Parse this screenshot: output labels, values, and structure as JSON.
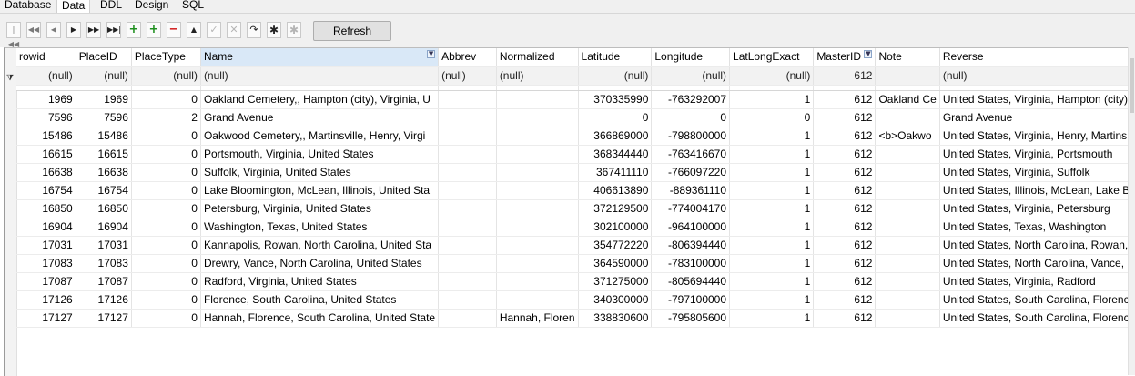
{
  "tabs": [
    {
      "label": "Database"
    },
    {
      "label": "Data"
    },
    {
      "label": "DDL"
    },
    {
      "label": "Design"
    },
    {
      "label": "SQL"
    }
  ],
  "toolbar": {
    "refresh_label": "Refresh",
    "buttons": [
      {
        "name": "first-record-button",
        "icon": "first-icon"
      },
      {
        "name": "prior-page-button",
        "icon": "prior-page-icon"
      },
      {
        "name": "prior-record-button",
        "icon": "prior-icon"
      },
      {
        "name": "next-record-button",
        "icon": "next-icon"
      },
      {
        "name": "next-page-button",
        "icon": "next-page-icon"
      },
      {
        "name": "last-record-button",
        "icon": "last-icon"
      },
      {
        "name": "insert-record-button",
        "icon": "plus-icon"
      },
      {
        "name": "insert-copy-button",
        "icon": "plus-copy-icon"
      },
      {
        "name": "delete-record-button",
        "icon": "minus-icon"
      },
      {
        "name": "edit-record-button",
        "icon": "caret-up-icon"
      },
      {
        "name": "post-edit-button",
        "icon": "checkmark-icon"
      },
      {
        "name": "cancel-edit-button",
        "icon": "x-icon"
      },
      {
        "name": "refresh-record-button",
        "icon": "redo-arrow-icon"
      },
      {
        "name": "apply-updates-button",
        "icon": "asterisk-icon"
      },
      {
        "name": "cancel-updates-button",
        "icon": "asterisk-light-icon"
      }
    ]
  },
  "grid": {
    "columns": [
      "rowid",
      "PlaceID",
      "PlaceType",
      "Name",
      "Abbrev",
      "Normalized",
      "Latitude",
      "Longitude",
      "LatLongExact",
      "MasterID",
      "Note",
      "Reverse"
    ],
    "filters": [
      "(null)",
      "(null)",
      "(null)",
      "(null)",
      "(null)",
      "(null)",
      "(null)",
      "(null)",
      "(null)",
      "612",
      "",
      "(null)"
    ],
    "rows": [
      [
        "1969",
        "1969",
        "0",
        "Oakland Cemetery,, Hampton (city), Virginia, U",
        "",
        "",
        "370335990",
        "-763292007",
        "1",
        "612",
        "Oakland Ce",
        "United States, Virginia, Hampton (city)"
      ],
      [
        "7596",
        "7596",
        "2",
        "Grand Avenue",
        "",
        "",
        "0",
        "0",
        "0",
        "612",
        "",
        "Grand Avenue"
      ],
      [
        "15486",
        "15486",
        "0",
        "Oakwood Cemetery,, Martinsville, Henry, Virgi",
        "",
        "",
        "366869000",
        "-798800000",
        "1",
        "612",
        "<b>Oakwo",
        "United States, Virginia, Henry, Martins"
      ],
      [
        "16615",
        "16615",
        "0",
        "Portsmouth, Virginia, United States",
        "",
        "",
        "368344440",
        "-763416670",
        "1",
        "612",
        "",
        "United States, Virginia, Portsmouth"
      ],
      [
        "16638",
        "16638",
        "0",
        "Suffolk, Virginia, United States",
        "",
        "",
        "367411110",
        "-766097220",
        "1",
        "612",
        "",
        "United States, Virginia, Suffolk"
      ],
      [
        "16754",
        "16754",
        "0",
        "Lake Bloomington, McLean, Illinois, United Sta",
        "",
        "",
        "406613890",
        "-889361110",
        "1",
        "612",
        "",
        "United States, Illinois, McLean, Lake Bl"
      ],
      [
        "16850",
        "16850",
        "0",
        "Petersburg, Virginia, United States",
        "",
        "",
        "372129500",
        "-774004170",
        "1",
        "612",
        "",
        "United States, Virginia, Petersburg"
      ],
      [
        "16904",
        "16904",
        "0",
        "Washington, Texas, United States",
        "",
        "",
        "302100000",
        "-964100000",
        "1",
        "612",
        "",
        "United States, Texas, Washington"
      ],
      [
        "17031",
        "17031",
        "0",
        "Kannapolis, Rowan, North Carolina, United Sta",
        "",
        "",
        "354772220",
        "-806394440",
        "1",
        "612",
        "",
        "United States, North Carolina, Rowan,"
      ],
      [
        "17083",
        "17083",
        "0",
        "Drewry, Vance, North Carolina, United States",
        "",
        "",
        "364590000",
        "-783100000",
        "1",
        "612",
        "",
        "United States, North Carolina, Vance, I"
      ],
      [
        "17087",
        "17087",
        "0",
        "Radford, Virginia, United States",
        "",
        "",
        "371275000",
        "-805694440",
        "1",
        "612",
        "",
        "United States, Virginia, Radford"
      ],
      [
        "17126",
        "17126",
        "0",
        "Florence, South Carolina, United States",
        "",
        "",
        "340300000",
        "-797100000",
        "1",
        "612",
        "",
        "United States, South Carolina, Florenc"
      ],
      [
        "17127",
        "17127",
        "0",
        "Hannah, Florence, South Carolina, United State",
        "",
        "Hannah, Floren",
        "338830600",
        "-795805600",
        "1",
        "612",
        "",
        "United States, South Carolina, Florenc"
      ]
    ]
  }
}
